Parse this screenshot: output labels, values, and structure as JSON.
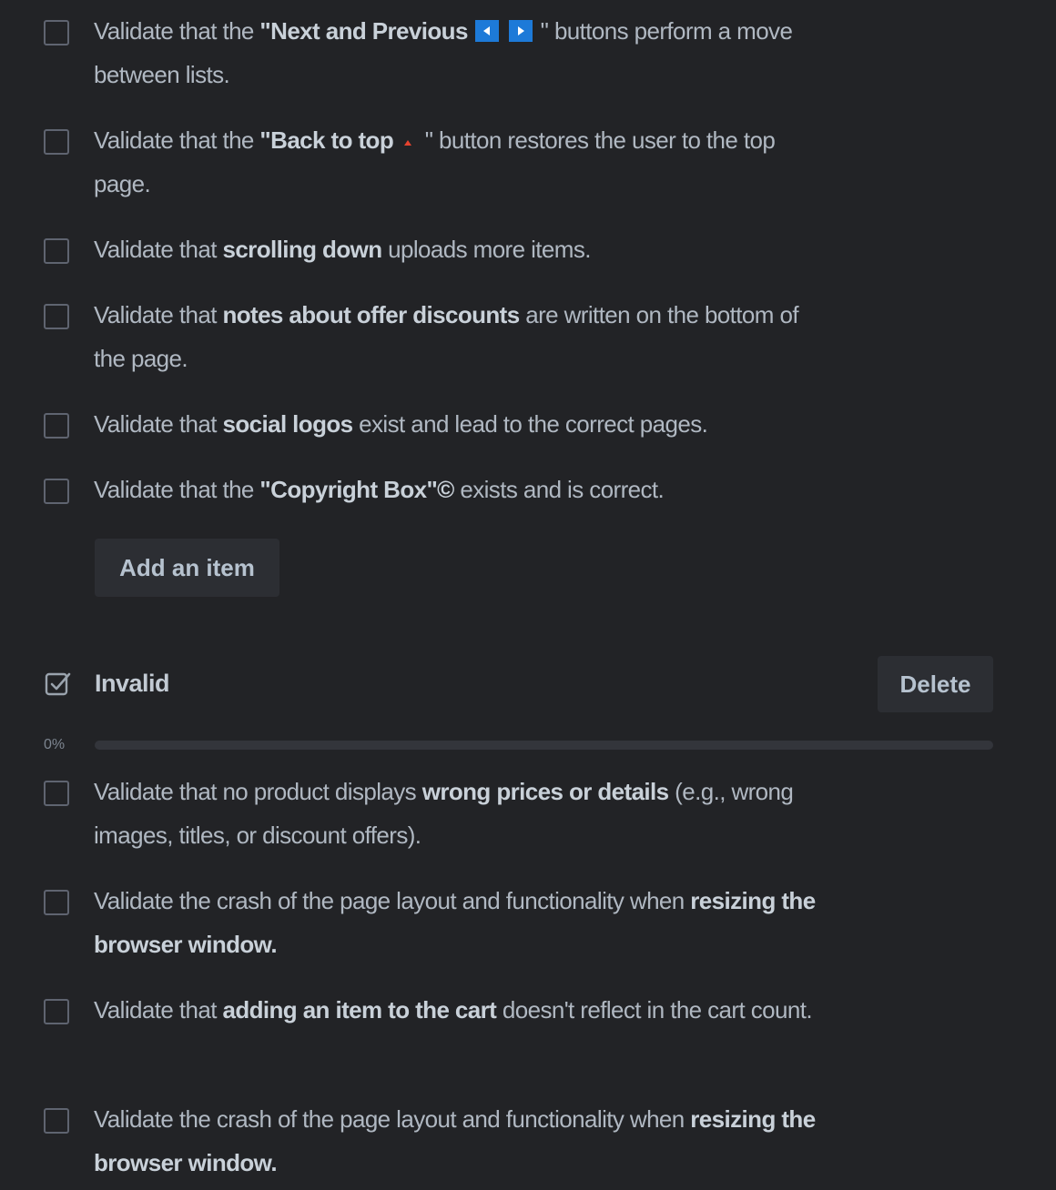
{
  "checklist_top": {
    "items": [
      {
        "prefix": "Validate that the ",
        "bold": "\"Next and Previous",
        "suffix": " \" buttons perform a move between lists."
      },
      {
        "prefix": "Validate that the ",
        "bold": "\"Back to top",
        "suffix": " \" button restores the user to the top page."
      },
      {
        "prefix": "Validate that ",
        "bold": "scrolling down",
        "suffix": " uploads more items."
      },
      {
        "prefix": "Validate that ",
        "bold": "notes about offer discounts",
        "suffix": " are written on the bottom of the page."
      },
      {
        "prefix": "Validate that ",
        "bold": "social logos",
        "suffix": " exist and lead to the correct pages."
      },
      {
        "prefix": "Validate that the ",
        "bold": "\"Copyright Box\"©",
        "suffix": " exists and is correct."
      }
    ],
    "add_item_label": "Add an item"
  },
  "invalid_section": {
    "title": "Invalid",
    "delete_label": "Delete",
    "progress_label": "0%",
    "progress_fraction": 0,
    "items": [
      {
        "prefix": "Validate that no product displays ",
        "bold": "wrong prices or details",
        "suffix": " (e.g., wrong images, titles, or discount offers)."
      },
      {
        "prefix": "Validate the crash of the page layout and functionality when ",
        "bold": "resizing the browser window.",
        "suffix": ""
      },
      {
        "prefix": "Validate that ",
        "bold": "adding an item to the cart",
        "suffix": " doesn't reflect in the cart count."
      },
      {
        "prefix": "Validate the crash of the page layout and functionality when ",
        "bold": "resizing the browser window.",
        "suffix": ""
      }
    ]
  },
  "icons": {
    "checkbox": "checkbox-icon",
    "checklist": "checklist-icon",
    "prev": "previous-arrow-icon",
    "next": "next-arrow-icon",
    "back_to_top": "up-arrow-icon"
  },
  "colors": {
    "background": "#222326",
    "text": "#b6c2cf",
    "button_bg": "#2c2e33",
    "nav_button": "#1d7ad8",
    "arrow_red": "#e5432f"
  }
}
